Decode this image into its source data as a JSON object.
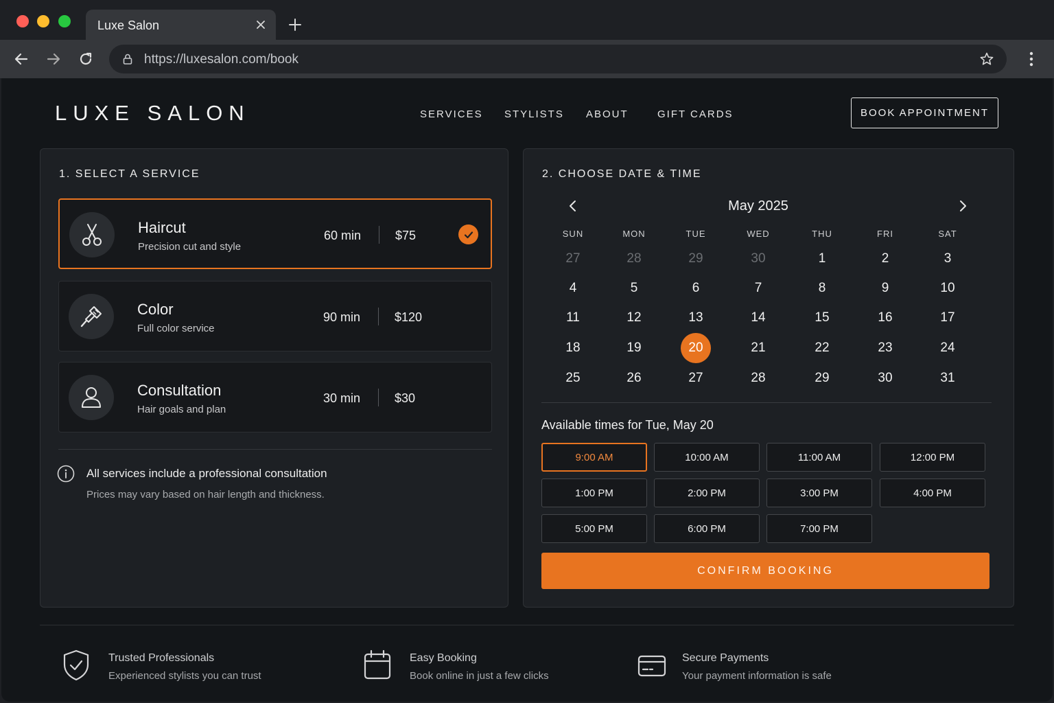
{
  "browser": {
    "tab_title": "Luxe Salon",
    "url": "https://luxesalon.com/book"
  },
  "header": {
    "logo": "LUXE SALON",
    "nav": [
      "SERVICES",
      "STYLISTS",
      "ABOUT",
      "GIFT CARDS"
    ],
    "book_button": "BOOK APPOINTMENT"
  },
  "services_panel": {
    "title": "1. SELECT A SERVICE",
    "items": [
      {
        "name": "Haircut",
        "description": "Precision cut and style",
        "duration": "60 min",
        "price": "$75",
        "icon": "scissors-icon",
        "selected": true
      },
      {
        "name": "Color",
        "description": "Full color service",
        "duration": "90 min",
        "price": "$120",
        "icon": "brush-icon",
        "selected": false
      },
      {
        "name": "Consultation",
        "description": "Hair goals and plan",
        "duration": "30 min",
        "price": "$30",
        "icon": "user-icon",
        "selected": false
      }
    ],
    "info_title": "All services include a professional consultation",
    "info_sub": "Prices may vary based on hair length and thickness."
  },
  "datetime_panel": {
    "title": "2. CHOOSE DATE & TIME",
    "month": "May 2025",
    "weekdays": [
      "SUN",
      "MON",
      "TUE",
      "WED",
      "THU",
      "FRI",
      "SAT"
    ],
    "weeks": [
      [
        "27",
        "28",
        "29",
        "30",
        "1",
        "2",
        "3"
      ],
      [
        "4",
        "5",
        "6",
        "7",
        "8",
        "9",
        "10"
      ],
      [
        "11",
        "12",
        "13",
        "14",
        "15",
        "16",
        "17"
      ],
      [
        "18",
        "19",
        "20",
        "21",
        "22",
        "23",
        "24"
      ],
      [
        "25",
        "26",
        "27",
        "28",
        "29",
        "30",
        "31"
      ]
    ],
    "muted_days_first_week": 4,
    "selected_day": "20",
    "available_title": "Available times for Tue, May 20",
    "times": [
      "9:00 AM",
      "10:00 AM",
      "11:00 AM",
      "12:00 PM",
      "1:00 PM",
      "2:00 PM",
      "3:00 PM",
      "4:00 PM",
      "5:00 PM",
      "6:00 PM",
      "7:00 PM"
    ],
    "selected_time": "9:00 AM",
    "confirm_button": "CONFIRM BOOKING"
  },
  "features": [
    {
      "title": "Trusted Professionals",
      "subtitle": "Experienced stylists you can trust",
      "icon": "shield-check-icon"
    },
    {
      "title": "Easy Booking",
      "subtitle": "Book online in just a few clicks",
      "icon": "calendar-icon"
    },
    {
      "title": "Secure Payments",
      "subtitle": "Your payment information is safe",
      "icon": "credit-card-icon"
    }
  ],
  "colors": {
    "accent": "#e87420",
    "page_background": "#131619",
    "panel_background": "#1d2024"
  }
}
